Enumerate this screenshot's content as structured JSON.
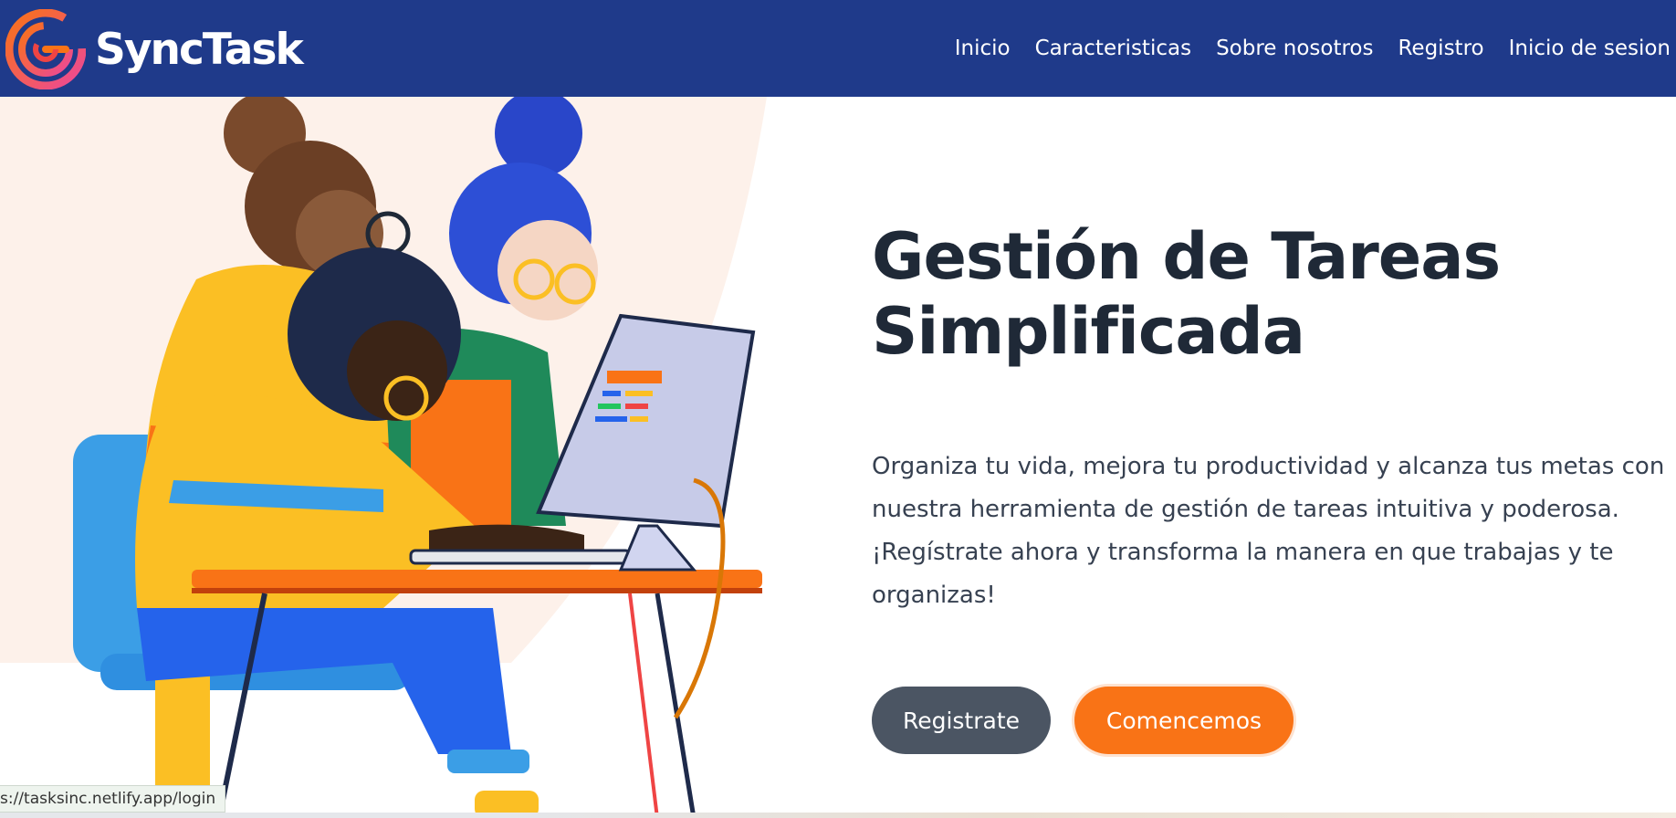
{
  "brand": {
    "name": "SyncTask"
  },
  "nav": {
    "items": [
      {
        "label": "Inicio"
      },
      {
        "label": "Caracteristicas"
      },
      {
        "label": "Sobre nosotros"
      },
      {
        "label": "Registro"
      },
      {
        "label": "Inicio de sesion"
      }
    ]
  },
  "hero": {
    "title_line1": "Gestión de Tareas",
    "title_line2": "Simplificada",
    "description": "Organiza tu vida, mejora tu productividad y alcanza tus metas con nuestra herramienta de gestión de tareas intuitiva y poderosa. ¡Regístrate ahora y transforma la manera en que trabajas y te organizas!",
    "buttons": {
      "register": "Registrate",
      "start": "Comencemos"
    }
  },
  "status_bar": {
    "url": "s://tasksinc.netlify.app/login"
  },
  "colors": {
    "navbar": "#1f3a8a",
    "title": "#1f2937",
    "btn_secondary": "#4b5563",
    "btn_primary": "#f97316"
  },
  "icons": {
    "logo": "spiral-logo-icon"
  }
}
